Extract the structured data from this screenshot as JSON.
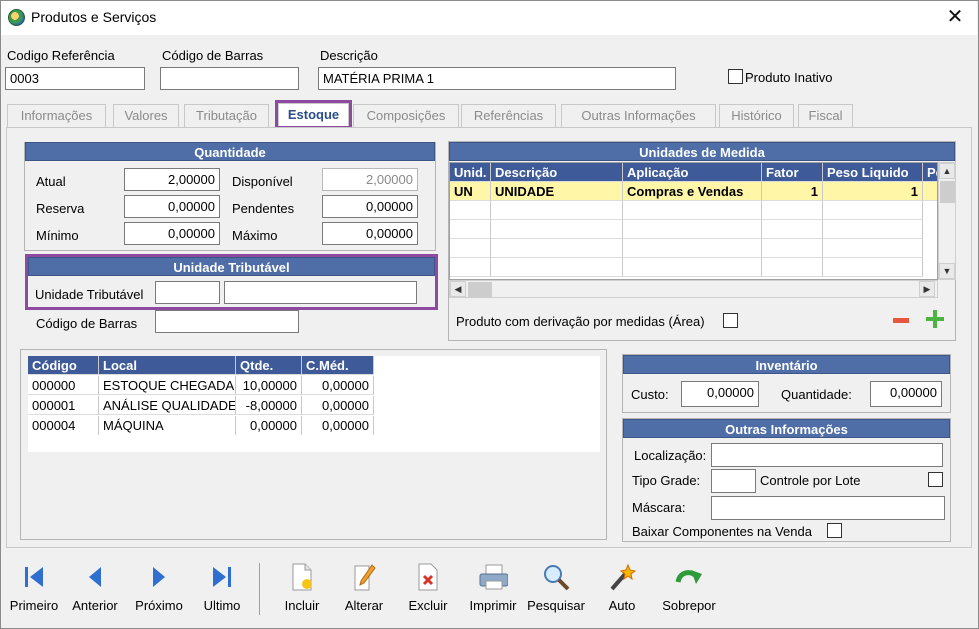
{
  "window": {
    "title": "Produtos e Serviços",
    "close": "✕"
  },
  "header": {
    "codigo_ref_label": "Codigo Referência",
    "codigo_ref_value": "0003",
    "codigo_barras_label": "Código de Barras",
    "codigo_barras_value": "",
    "descricao_label": "Descrição",
    "descricao_value": "MATÉRIA PRIMA 1",
    "inativo_label": "Produto Inativo"
  },
  "tabs": [
    "Informações",
    "Valores",
    "Tributação",
    "Estoque",
    "Composições",
    "Referências",
    "Outras Informações",
    "Histórico",
    "Fiscal"
  ],
  "quantidade": {
    "title": "Quantidade",
    "atual_label": "Atual",
    "atual": "2,00000",
    "disponivel_label": "Disponível",
    "disponivel": "2,00000",
    "reserva_label": "Reserva",
    "reserva": "0,00000",
    "pendentes_label": "Pendentes",
    "pendentes": "0,00000",
    "minimo_label": "Mínimo",
    "minimo": "0,00000",
    "maximo_label": "Máximo",
    "maximo": "0,00000"
  },
  "unidade_tributavel": {
    "title": "Unidade Tributável",
    "label": "Unidade Tributável",
    "codigo_barras_label": "Código de Barras"
  },
  "unidades_medida": {
    "title": "Unidades de Medida",
    "columns": [
      "Unid.",
      "Descrição",
      "Aplicação",
      "Fator",
      "Peso Liquido",
      "Pe"
    ],
    "row": [
      "UN",
      "UNIDADE",
      "Compras e Vendas",
      "1",
      "1"
    ],
    "derivacao_label": "Produto com derivação por medidas (Área)"
  },
  "estoque_local": {
    "columns": [
      "Código",
      "Local",
      "Qtde.",
      "C.Méd."
    ],
    "rows": [
      [
        "000000",
        "ESTOQUE CHEGADA",
        "10,00000",
        "0,00000"
      ],
      [
        "000001",
        "ANÁLISE QUALIDADE",
        "-8,00000",
        "0,00000"
      ],
      [
        "000004",
        "MÁQUINA",
        "0,00000",
        "0,00000"
      ]
    ]
  },
  "inventario": {
    "title": "Inventário",
    "custo_label": "Custo:",
    "custo": "0,00000",
    "quantidade_label": "Quantidade:",
    "quantidade": "0,00000"
  },
  "outras": {
    "title": "Outras Informações",
    "localizacao_label": "Localização:",
    "tipo_grade_label": "Tipo Grade:",
    "controle_lote_label": "Controle por Lote",
    "mascara_label": "Máscara:",
    "baixar_label": "Baixar Componentes na Venda"
  },
  "toolbar": {
    "primeiro": "Primeiro",
    "anterior": "Anterior",
    "proximo": "Próximo",
    "ultimo": "Ultimo",
    "incluir": "Incluir",
    "alterar": "Alterar",
    "excluir": "Excluir",
    "imprimir": "Imprimir",
    "pesquisar": "Pesquisar",
    "auto": "Auto",
    "sobrepor": "Sobrepor"
  },
  "colors": {
    "header_blue": "#4f6da7",
    "highlight_purple": "#8e4aa0",
    "selected_row": "#fff6a8",
    "nav_blue": "#2e6fd0"
  }
}
